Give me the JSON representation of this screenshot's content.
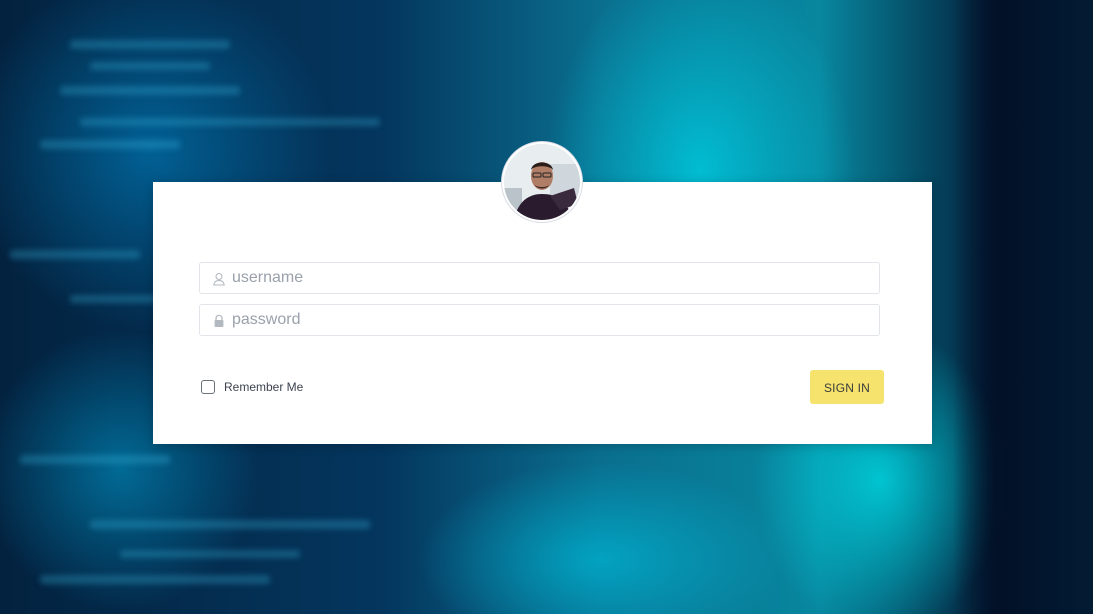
{
  "login": {
    "username_placeholder": "username",
    "password_placeholder": "password",
    "remember_label": "Remember Me",
    "remember_checked": false,
    "signin_label": "SIGN IN"
  },
  "icons": {
    "username": "user-icon",
    "password": "lock-icon",
    "avatar": "profile-photo"
  },
  "colors": {
    "button": "#f5e36d",
    "card": "#ffffff",
    "placeholder": "#9aa1ab"
  }
}
